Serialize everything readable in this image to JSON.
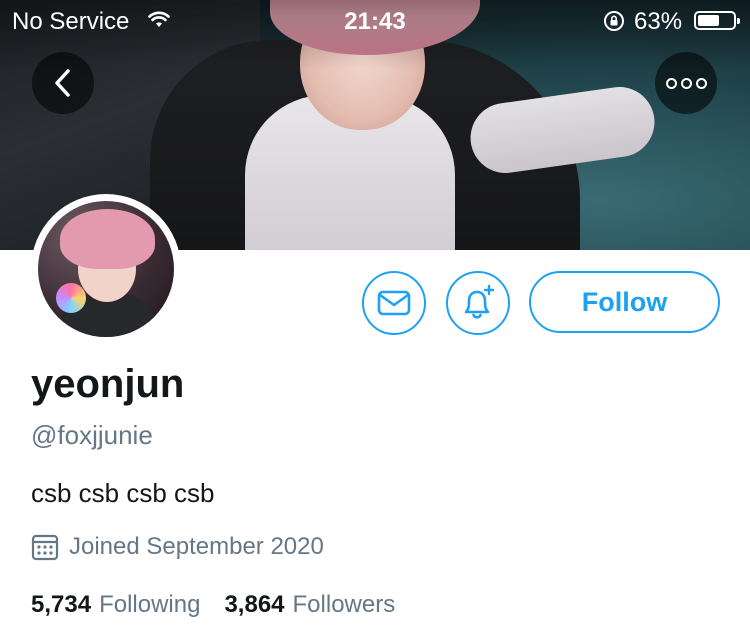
{
  "status_bar": {
    "carrier": "No Service",
    "time": "21:43",
    "battery_percent": "63%",
    "battery_level": 0.63
  },
  "header": {
    "back_icon": "chevron-left-icon",
    "more_icon": "more-horizontal-icon"
  },
  "actions": {
    "message_icon": "envelope-icon",
    "notify_icon": "bell-plus-icon",
    "follow_label": "Follow"
  },
  "profile": {
    "name": "yeonjun",
    "handle": "@foxjjunie",
    "bio": "csb csb csb csb",
    "joined": "Joined September 2020",
    "following_count": "5,734",
    "following_label": "Following",
    "followers_count": "3,864",
    "followers_label": "Followers"
  },
  "colors": {
    "accent": "#1da1f2",
    "secondary_text": "#657786",
    "primary_text": "#14171a"
  }
}
